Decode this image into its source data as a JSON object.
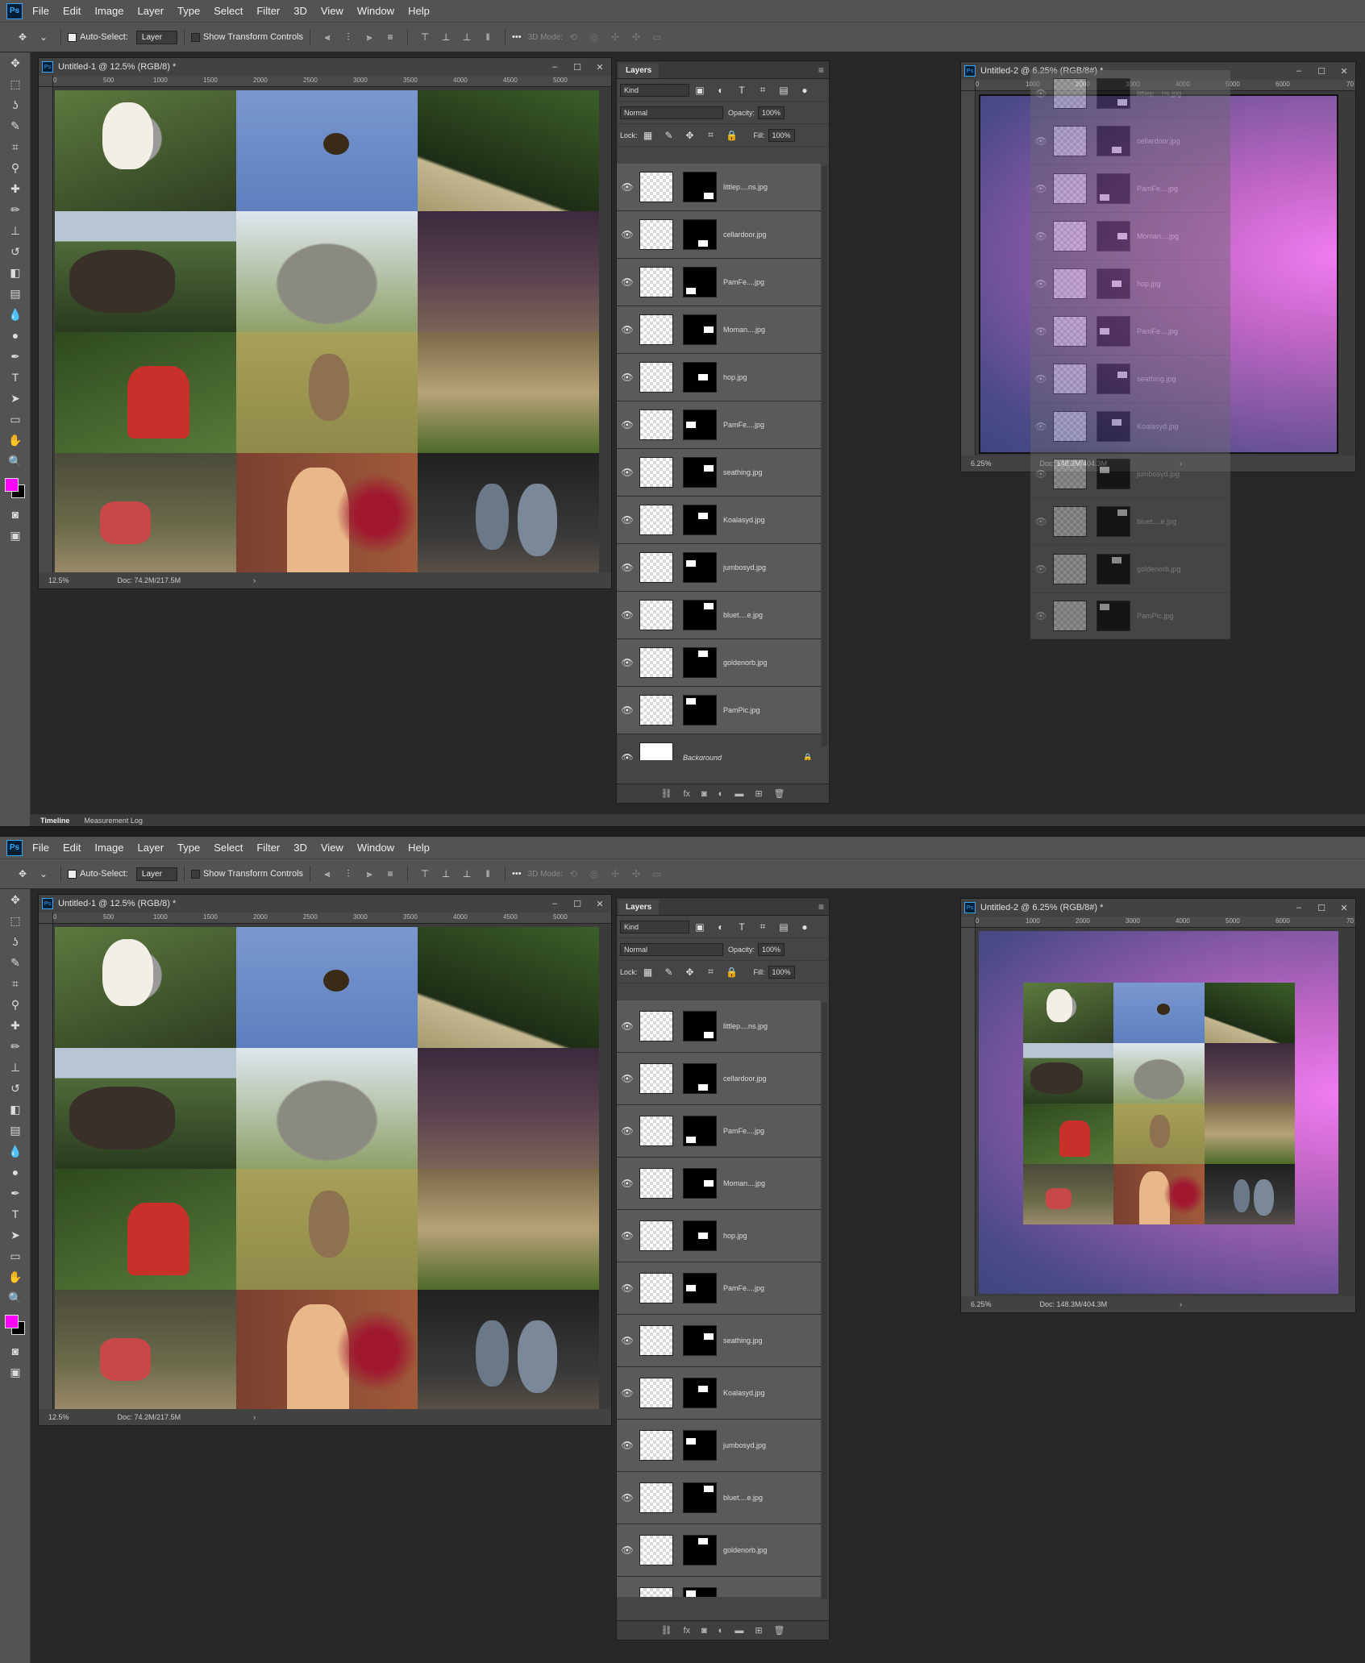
{
  "app": {
    "logo": "Ps"
  },
  "menu": [
    "File",
    "Edit",
    "Image",
    "Layer",
    "Type",
    "Select",
    "Filter",
    "3D",
    "View",
    "Window",
    "Help"
  ],
  "options": {
    "auto_select": "Auto-Select:",
    "auto_select_target": "Layer",
    "show_transform": "Show Transform Controls",
    "more": "•••",
    "mode_3d": "3D Mode:"
  },
  "doc1": {
    "title": "Untitled-1 @ 12.5% (RGB/8) *",
    "ruler": [
      "0",
      "500",
      "1000",
      "1500",
      "2000",
      "2500",
      "3000",
      "3500",
      "4000",
      "4500",
      "5000"
    ],
    "zoom": "12.5%",
    "doc_size": "Doc: 74.2M/217.5M",
    "arrow": "›"
  },
  "doc2": {
    "title": "Untitled-2 @ 6.25% (RGB/8#) *",
    "ruler": [
      "0",
      "1000",
      "2000",
      "3000",
      "4000",
      "5000",
      "6000",
      "70"
    ],
    "zoom": "6.25%",
    "doc_size": "Doc: 148.3M/404.3M",
    "arrow": "›"
  },
  "layers_panel": {
    "tab": "Layers",
    "kind": "Kind",
    "blend": "Normal",
    "opacity_label": "Opacity:",
    "opacity": "100%",
    "lock_label": "Lock:",
    "fill_label": "Fill:",
    "fill": "100%",
    "layers": [
      "littlep....ns.jpg",
      "cellardoor.jpg",
      "PamFe....jpg",
      "Moman....jpg",
      "hop.jpg",
      "PamFe....jpg",
      "seathing.jpg",
      "Koalasyd.jpg",
      "jumbosyd.jpg",
      "bluet....e.jpg",
      "goldenorb.jpg",
      "PamPic.jpg"
    ],
    "background": "Background",
    "footer_icons": [
      "link",
      "fx",
      "mask",
      "adjust",
      "group",
      "new",
      "trash"
    ]
  },
  "timeline": {
    "tabs": [
      "Timeline",
      "Measurement Log"
    ]
  },
  "colors": {
    "foreground": "#ff00ff",
    "background": "#000000"
  }
}
